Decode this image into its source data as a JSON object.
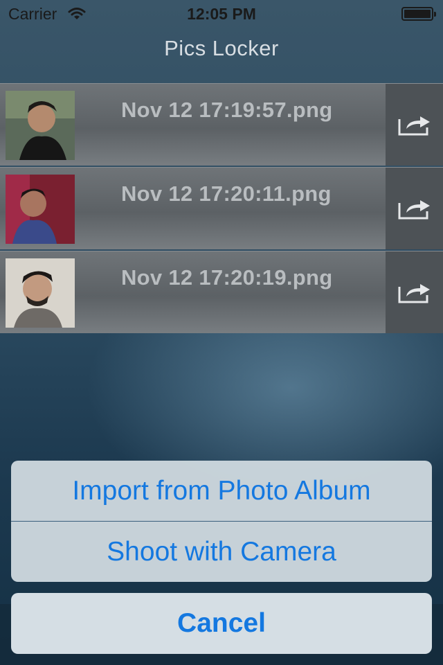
{
  "status_bar": {
    "carrier": "Carrier",
    "time": "12:05 PM"
  },
  "nav": {
    "title": "Pics Locker"
  },
  "files": [
    {
      "name": "Nov 12 17:19:57.png",
      "thumb_icon": "person-photo-icon"
    },
    {
      "name": "Nov 12 17:20:11.png",
      "thumb_icon": "person-photo-icon"
    },
    {
      "name": "Nov 12 17:20:19.png",
      "thumb_icon": "person-photo-icon"
    }
  ],
  "action_sheet": {
    "import_label": "Import from Photo Album",
    "camera_label": "Shoot with Camera",
    "cancel_label": "Cancel"
  },
  "colors": {
    "accent": "#1478e0",
    "background": "#2b4a60"
  }
}
